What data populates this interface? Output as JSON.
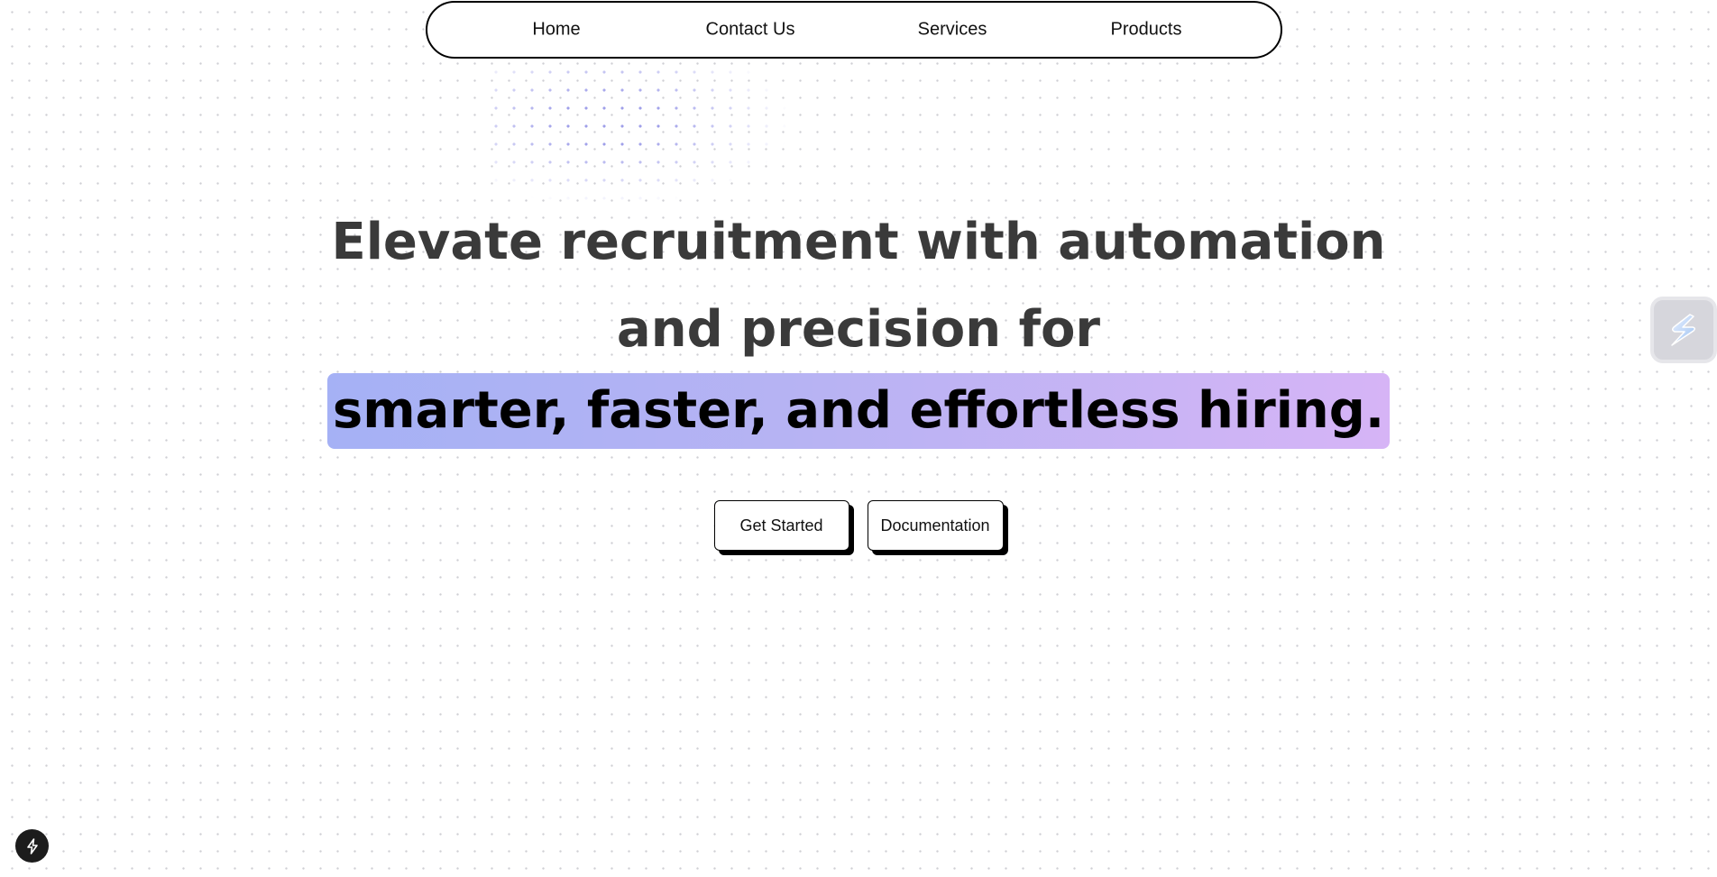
{
  "nav": {
    "items": [
      {
        "label": "Home"
      },
      {
        "label": "Contact Us"
      },
      {
        "label": "Services"
      },
      {
        "label": "Products"
      }
    ]
  },
  "hero": {
    "line1": "Elevate recruitment with automation",
    "line2": "and precision for",
    "highlight": "smarter, faster, and effortless hiring."
  },
  "actions": {
    "get_started_label": "Get Started",
    "documentation_label": "Documentation"
  },
  "icons": {
    "side_widget": "s-logo-icon",
    "corner_badge": "bolt-icon"
  },
  "colors": {
    "headline_text": "#3a3a3a",
    "highlight_gradient_start": "#a5b1f5",
    "highlight_gradient_end": "#d6b4f6",
    "button_border": "#000000"
  }
}
